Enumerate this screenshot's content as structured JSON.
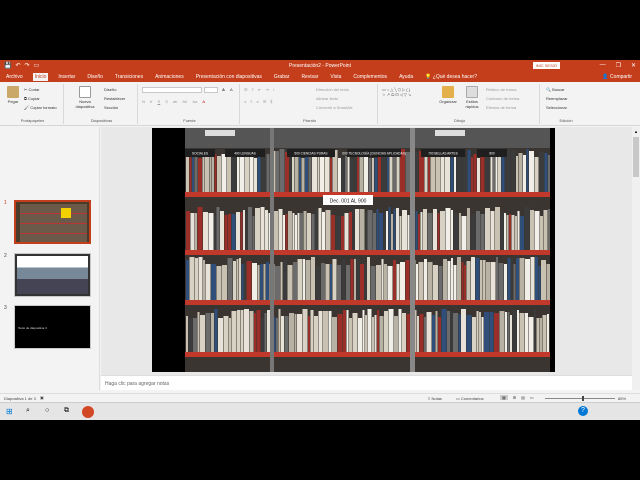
{
  "window": {
    "title": "Presentación2 - PowerPoint",
    "signin_label": "INIC SESIÓ",
    "qat": [
      "save-icon",
      "undo-icon",
      "redo-icon",
      "present-icon"
    ],
    "controls": [
      "—",
      "❐",
      "✕"
    ]
  },
  "tabs": {
    "items": [
      "Archivo",
      "Inicio",
      "Insertar",
      "Diseño",
      "Transiciones",
      "Animaciones",
      "Presentación con diapositivas",
      "Grabar",
      "Revisar",
      "Vista",
      "Complementos",
      "Ayuda"
    ],
    "active": "Inicio",
    "tell_me": "¿Qué desea hacer?",
    "share": "Compartir"
  },
  "ribbon": {
    "clipboard": {
      "paste": "Pegar",
      "cut": "Cortar",
      "copy": "Copiar",
      "format_painter": "Copiar formato",
      "group_label": "Portapapeles"
    },
    "slides": {
      "new_slide": "Nueva diapositiva",
      "layout": "Diseño",
      "reset": "Restablecer",
      "section": "Sección",
      "group_label": "Diapositivas"
    },
    "font": {
      "group_label": "Fuente",
      "grow": "A",
      "shrink": "A"
    },
    "paragraph": {
      "group_label": "Párrafo",
      "text_direction": "Dirección del texto",
      "align_text": "Alinear texto",
      "smartart": "Convertir a SmartArt"
    },
    "drawing": {
      "arrange": "Organizar",
      "quick_styles": "Estilos rápidos",
      "fill": "Relleno de forma",
      "outline": "Contorno de forma",
      "effects": "Efectos de forma",
      "group_label": "Dibujo"
    },
    "editing": {
      "find": "Buscar",
      "replace": "Reemplazar",
      "select": "Seleccionar",
      "group_label": "Edición"
    }
  },
  "thumbnails": [
    {
      "number": "1",
      "selected": true,
      "text": ""
    },
    {
      "number": "2",
      "selected": false,
      "text": ""
    },
    {
      "number": "3",
      "selected": false,
      "text": "Texto de diapositiva 3"
    }
  ],
  "slide_image": {
    "signs": [
      "SOCIALES",
      "400 LENGUAS",
      "500 CIENCIAS PURAS",
      "600 TECNOLOGÍA (CIENCIAS APLICADAS)",
      "700 BELLAS ARTES",
      "800"
    ],
    "call_number": "Dec. 001 AL 900"
  },
  "notes_placeholder": "Haga clic para agregar notas",
  "statusbar": {
    "slide_info": "Diapositiva 1 de 3",
    "notes": "Notas",
    "comments": "Comentarios",
    "zoom": "85%"
  },
  "taskbar": {
    "icons": [
      "windows-icon",
      "search-icon",
      "cortana-icon",
      "task-view-icon",
      "powerpoint-icon"
    ]
  },
  "colors": {
    "accent": "#c43e1c",
    "shelf_red": "#c0392b"
  }
}
